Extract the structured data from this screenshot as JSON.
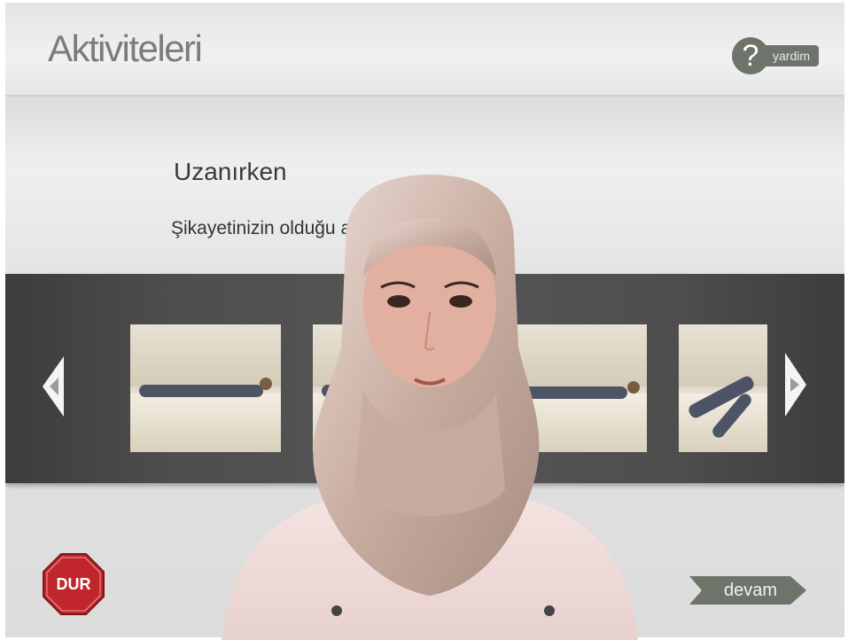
{
  "header": {
    "title": "Aktiviteleri",
    "help_label": "yardim",
    "help_glyph": "?"
  },
  "prompt": {
    "subtitle": "Uzanırken",
    "instruction": "Şikayetinizin olduğu aktiviteleri tıklayınız."
  },
  "carousel": {
    "items": [
      "lying-on-bed",
      "lying-on-bed",
      "lying-on-bed",
      "lying-knees-up"
    ]
  },
  "footer": {
    "stop_label": "DUR",
    "next_label": "devam"
  },
  "colors": {
    "stop_red": "#c0262c",
    "button_gray": "#6d7469",
    "carousel_bg": "#4e4e4e"
  }
}
